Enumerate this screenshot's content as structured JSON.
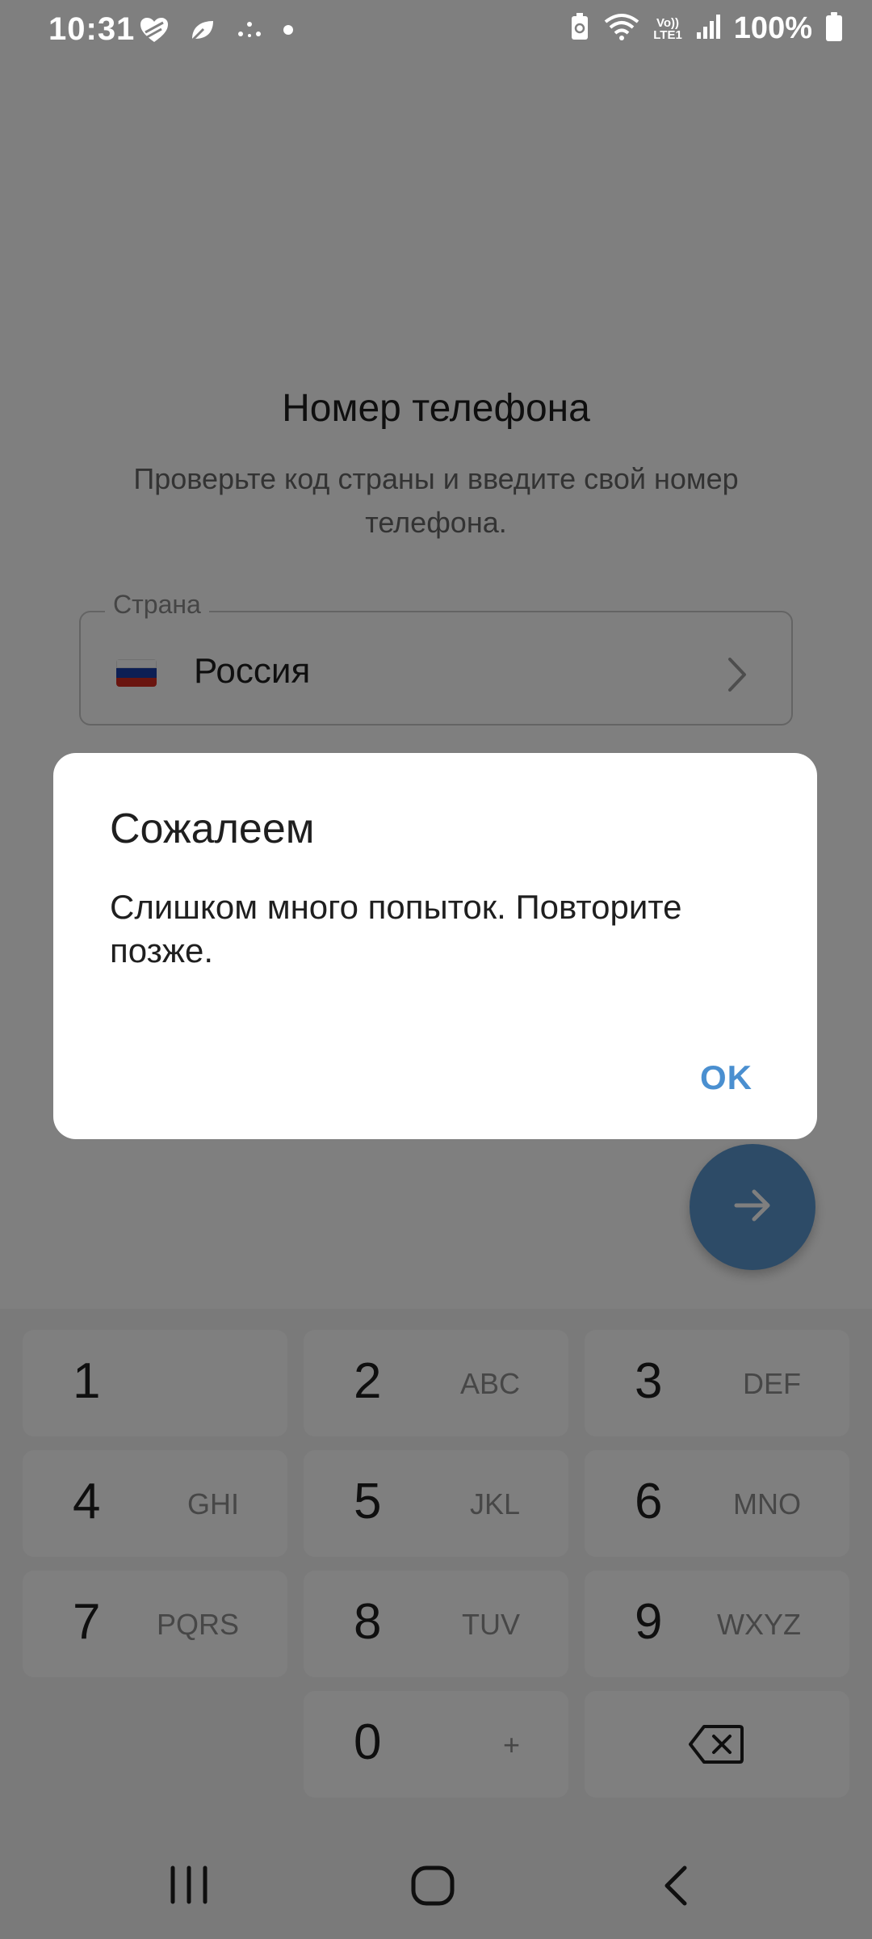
{
  "status_bar": {
    "time": "10:31",
    "battery": "100%",
    "left_icons": [
      "heart-shield-icon",
      "leaf-icon",
      "sparkle-icon",
      "dot-icon"
    ],
    "right_icons": [
      "battery-saver-icon",
      "wifi-icon",
      "volte-icon",
      "signal-icon",
      "battery-icon"
    ],
    "network_label_top": "Vo))",
    "network_label_bottom": "LTE1"
  },
  "header": {
    "title": "Номер телефона",
    "subtitle": "Проверьте код страны и введите свой номер телефона."
  },
  "country": {
    "label": "Страна",
    "name": "Россия",
    "flag_colors": [
      "#ffffff",
      "#1a3fa8",
      "#d52b1e"
    ]
  },
  "dialog": {
    "title": "Сожалеем",
    "message": "Слишком много попыток. Повторите позже.",
    "ok_label": "OK"
  },
  "keypad": {
    "keys": [
      {
        "num": "1",
        "letters": ""
      },
      {
        "num": "2",
        "letters": "ABC"
      },
      {
        "num": "3",
        "letters": "DEF"
      },
      {
        "num": "4",
        "letters": "GHI"
      },
      {
        "num": "5",
        "letters": "JKL"
      },
      {
        "num": "6",
        "letters": "MNO"
      },
      {
        "num": "7",
        "letters": "PQRS"
      },
      {
        "num": "8",
        "letters": "TUV"
      },
      {
        "num": "9",
        "letters": "WXYZ"
      },
      {
        "num": "0",
        "letters": "+"
      }
    ],
    "backspace_icon": "backspace-icon"
  },
  "fab": {
    "icon": "arrow-right-icon",
    "color": "#5b97cf"
  },
  "nav": {
    "icons": [
      "recent-apps-icon",
      "home-icon",
      "back-icon"
    ]
  },
  "colors": {
    "accent": "#4a8fd0",
    "scrim": "rgba(0,0,0,0.5)"
  }
}
